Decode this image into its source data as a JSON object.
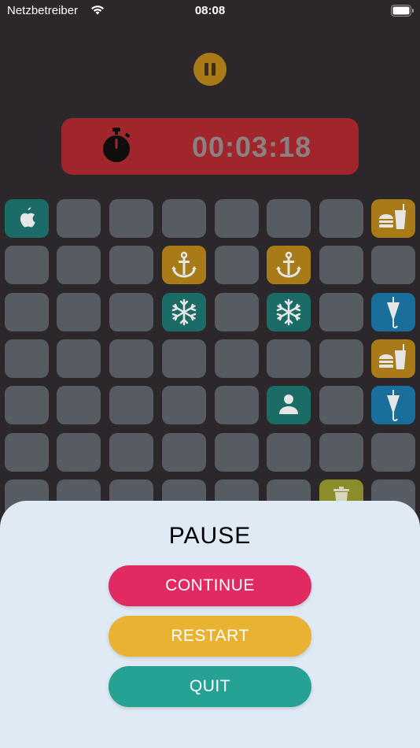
{
  "status_bar": {
    "carrier": "Netzbetreiber",
    "time": "08:08"
  },
  "timer": {
    "value": "00:03:18"
  },
  "grid": {
    "rows": [
      [
        "apple",
        "",
        "",
        "",
        "",
        "",
        "",
        "burger"
      ],
      [
        "",
        "",
        "",
        "anchor",
        "",
        "anchor",
        "",
        ""
      ],
      [
        "",
        "",
        "",
        "snowflake",
        "",
        "snowflake",
        "",
        "umbrella"
      ],
      [
        "",
        "",
        "",
        "",
        "",
        "",
        "",
        "burger"
      ],
      [
        "",
        "",
        "",
        "",
        "",
        "person",
        "",
        "umbrella"
      ],
      [
        "",
        "",
        "",
        "",
        "",
        "",
        "",
        ""
      ],
      [
        "",
        "",
        "",
        "",
        "",
        "",
        "trash",
        ""
      ]
    ]
  },
  "pause_menu": {
    "title": "PAUSE",
    "continue_label": "CONTINUE",
    "restart_label": "RESTART",
    "quit_label": "QUIT"
  },
  "colors": {
    "background": "#2b272b",
    "tile": "#575c62",
    "continue": "#e02a61",
    "restart": "#e9b233",
    "quit": "#25a294",
    "timer_panel": "#a1262b",
    "icon_teal": "#1b6b66",
    "icon_gold": "#a87b18",
    "icon_blue": "#1a6e9b"
  }
}
